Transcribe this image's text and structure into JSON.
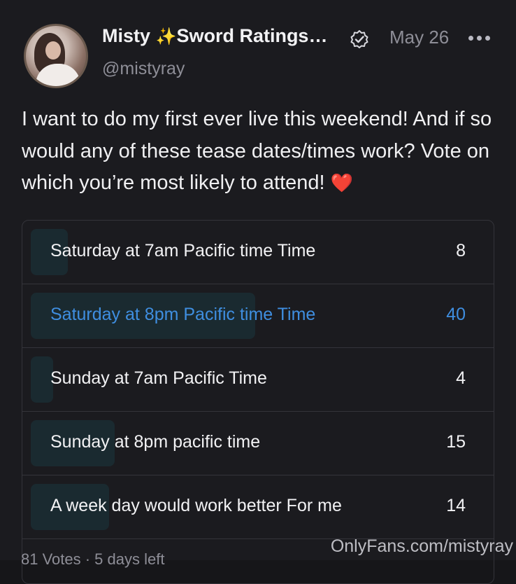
{
  "post": {
    "author_name": "Misty",
    "author_name_rest": "Sword Ratings…",
    "sparkle_icon": "✨",
    "handle": "@mistyray",
    "date": "May 26",
    "text": "I want to do my first ever live this weekend! And if so would any of these tease dates/times work? Vote on which you’re most likely to attend!",
    "heart_icon": "❤️"
  },
  "poll": {
    "options": [
      {
        "label": "Saturday at 7am Pacific time Time",
        "votes": "8",
        "share": 0.081
      },
      {
        "label": "Saturday at 8pm Pacific time Time",
        "votes": "40",
        "share": 0.494,
        "selected": true
      },
      {
        "label": "Sunday at 7am Pacific Time",
        "votes": "4",
        "share": 0.049
      },
      {
        "label": "Sunday at 8pm pacific time",
        "votes": "15",
        "share": 0.185
      },
      {
        "label": "A week day would work better For me",
        "votes": "14",
        "share": 0.173
      }
    ],
    "footer": "81 Votes · 5 days left"
  },
  "watermark": "OnlyFans.com/mistyray",
  "colors": {
    "accent": "#3f8ee0",
    "background": "#1b1b1f",
    "fill": "#1a2a30"
  }
}
